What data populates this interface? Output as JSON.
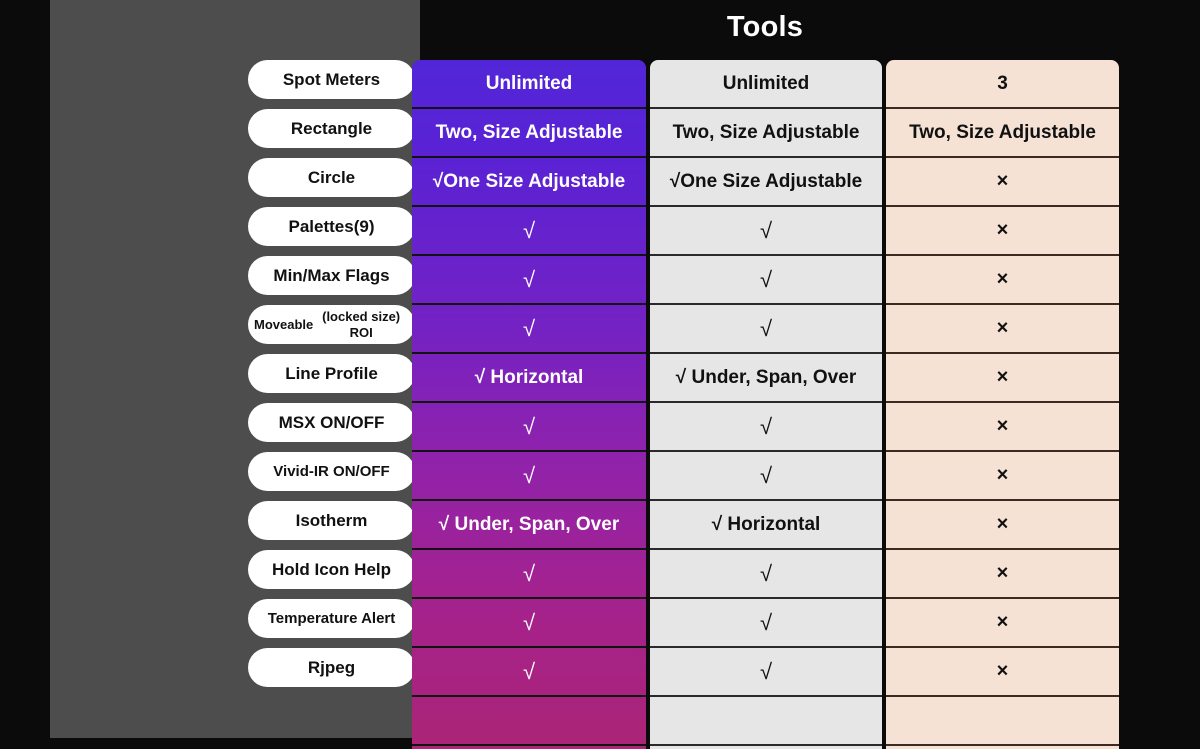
{
  "header": {
    "title": "Tools"
  },
  "colors": {
    "background": "#0b0b0b",
    "panel": "#4d4d4d",
    "col1_top": "#5226d8",
    "col1_bottom": "#ab2476",
    "col2": "#e6e6e6",
    "col3": "#f5e2d5",
    "pill": "#ffffff"
  },
  "glyphs": {
    "check": "√",
    "cross": "×"
  },
  "rows": [
    {
      "label": "Spot Meters",
      "col1": "Unlimited",
      "col2": "Unlimited",
      "col3": "3"
    },
    {
      "label": "Rectangle",
      "col1": "Two, Size Adjustable",
      "col2": "Two, Size Adjustable",
      "col3": "Two, Size Adjustable"
    },
    {
      "label": "Circle",
      "col1": "√One Size Adjustable",
      "col2": "√One Size Adjustable",
      "col3": "×"
    },
    {
      "label": "Palettes(9)",
      "col1": "√",
      "col2": "√",
      "col3": "×"
    },
    {
      "label": "Min/Max Flags",
      "col1": "√",
      "col2": "√",
      "col3": "×"
    },
    {
      "label": "Moveable\n(locked size) ROI",
      "col1": "√",
      "col2": "√",
      "col3": "×"
    },
    {
      "label": "Line Profile",
      "col1": "√ Horizontal",
      "col2": "√ Under, Span, Over",
      "col3": "×"
    },
    {
      "label": "MSX ON/OFF",
      "col1": "√",
      "col2": "√",
      "col3": "×"
    },
    {
      "label": "Vivid-IR ON/OFF",
      "col1": "√",
      "col2": "√",
      "col3": "×"
    },
    {
      "label": "Isotherm",
      "col1": "√ Under, Span, Over",
      "col2": "√ Horizontal",
      "col3": "×"
    },
    {
      "label": "Hold Icon Help",
      "col1": "√",
      "col2": "√",
      "col3": "×"
    },
    {
      "label": "Temperature Alert",
      "col1": "√",
      "col2": "√",
      "col3": "×"
    },
    {
      "label": "Rjpeg",
      "col1": "√",
      "col2": "√",
      "col3": "×"
    },
    {
      "label": "",
      "col1": "",
      "col2": "",
      "col3": ""
    }
  ]
}
